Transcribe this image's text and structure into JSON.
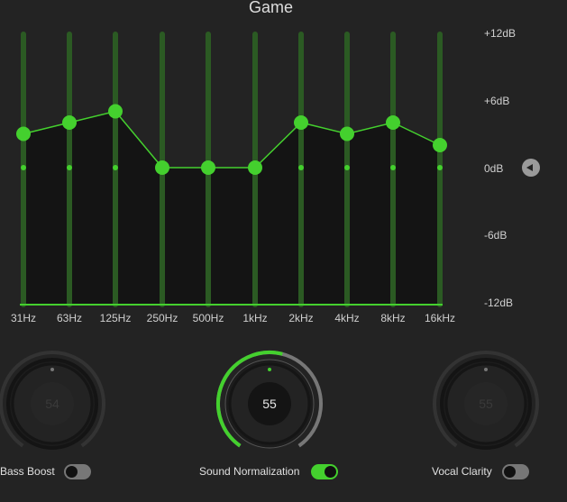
{
  "title": "Game",
  "colors": {
    "accent": "#44d02e",
    "track": "#2b5a23",
    "bg": "#232323"
  },
  "db_labels": [
    "+12dB",
    "+6dB",
    "0dB",
    "-6dB",
    "-12dB"
  ],
  "reset_icon": "triangle-left-icon",
  "chart_data": {
    "type": "line",
    "categories": [
      "31Hz",
      "63Hz",
      "125Hz",
      "250Hz",
      "500Hz",
      "1kHz",
      "2kHz",
      "4kHz",
      "8kHz",
      "16kHz"
    ],
    "values": [
      3,
      4,
      5,
      0,
      0,
      0,
      4,
      3,
      4,
      2
    ],
    "ylim": [
      -12,
      12
    ],
    "ylabel": "dB"
  },
  "knobs": [
    {
      "label": "Bass Boost",
      "value": "54",
      "enabled": false
    },
    {
      "label": "Sound Normalization",
      "value": "55",
      "enabled": true
    },
    {
      "label": "Vocal Clarity",
      "value": "55",
      "enabled": false
    }
  ]
}
